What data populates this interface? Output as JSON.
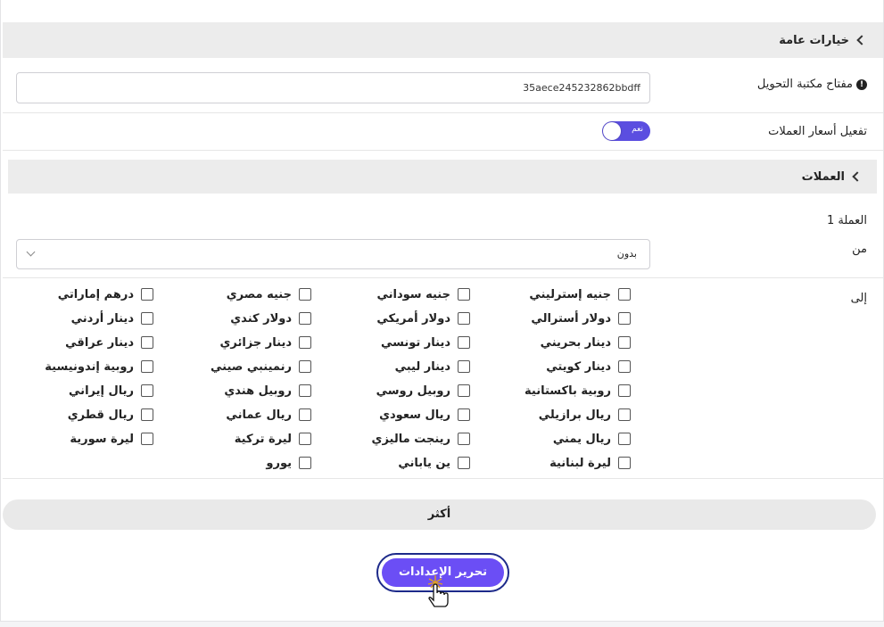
{
  "general": {
    "title": "خيارات عامة",
    "key_label": "مفتاح مكتبة التحويل",
    "key_value": "35aece245232862bbdff",
    "rates_label": "تفعيل أسعار العملات",
    "rates_toggle": "نعم"
  },
  "currencies": {
    "title": "العملات",
    "currency_label": "العملة 1",
    "from_label": "من",
    "from_value": "بدون",
    "to_label": "إلى",
    "options": [
      [
        "جنيه إسترليني",
        "جنيه سوداني",
        "جنيه مصري",
        "درهم إماراتي"
      ],
      [
        "دولار أسترالي",
        "دولار أمريكي",
        "دولار كندي",
        "دينار أردني"
      ],
      [
        "دينار بحريني",
        "دينار تونسي",
        "دينار جزائري",
        "دينار عراقي"
      ],
      [
        "دينار كويتي",
        "دينار ليبي",
        "رنمينبي صيني",
        "روبية إندونيسية"
      ],
      [
        "روبية باكستانية",
        "روبيل روسي",
        "روبيل هندي",
        "ريال إيراني"
      ],
      [
        "ريال برازيلي",
        "ريال سعودي",
        "ريال عماني",
        "ريال قطري"
      ],
      [
        "ريال يمني",
        "رينجت ماليزي",
        "ليرة تركية",
        "ليرة سورية"
      ],
      [
        "ليرة لبنانية",
        "ين ياباني",
        "يورو",
        ""
      ]
    ]
  },
  "more_label": "أكثر",
  "edit_button": "تحرير الإعدادات",
  "colors": {
    "accent": "#6b4ef5",
    "toggle": "#5b4ee0"
  }
}
